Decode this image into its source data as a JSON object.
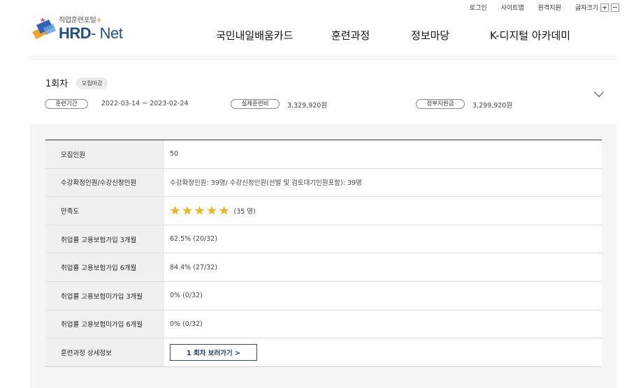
{
  "util_links": {
    "login": "로그인",
    "sitemap": "사이트맵",
    "remote": "원격지원",
    "font_size": "글자크기"
  },
  "logo": {
    "sub": "직업훈련포털",
    "sub_plus": "+",
    "main_a": "HRD",
    "main_b": "- Net"
  },
  "nav": {
    "card": "국민내일배움카드",
    "course": "훈련과정",
    "info": "정보마당",
    "kdigital": "K-디지털 아카데미"
  },
  "session": {
    "round": "1회차",
    "badge": "모집마감",
    "period_label": "훈련기간",
    "period_value": "2022-03-14 ~ 2023-02-24",
    "cost_label": "실제훈련비",
    "cost_value": "3,329,920원",
    "gov_label": "정부지원금",
    "gov_value": "3,299,920원"
  },
  "detail": {
    "rows": [
      {
        "label": "모집인원",
        "value": "50"
      },
      {
        "label": "수강확정인원/수강신청인원",
        "value": "수강확정인원:  39명/  수강신청인원(선발 및 검토대기인원포함):  39명"
      },
      {
        "label": "만족도",
        "value": "(35 명)"
      },
      {
        "label": "취업률 고용보험가입 3개월",
        "value": "62.5% (20/32)"
      },
      {
        "label": "취업률 고용보험가입 6개월",
        "value": "84.4% (27/32)"
      },
      {
        "label": "취업률 고용보험미가입 3개월",
        "value": "0% (0/32)"
      },
      {
        "label": "취업률 고용보험미가입 6개월",
        "value": "0% (0/32)"
      },
      {
        "label": "훈련과정 상세정보",
        "value": "1 회차 보러가기 >"
      }
    ],
    "rating": 5
  }
}
